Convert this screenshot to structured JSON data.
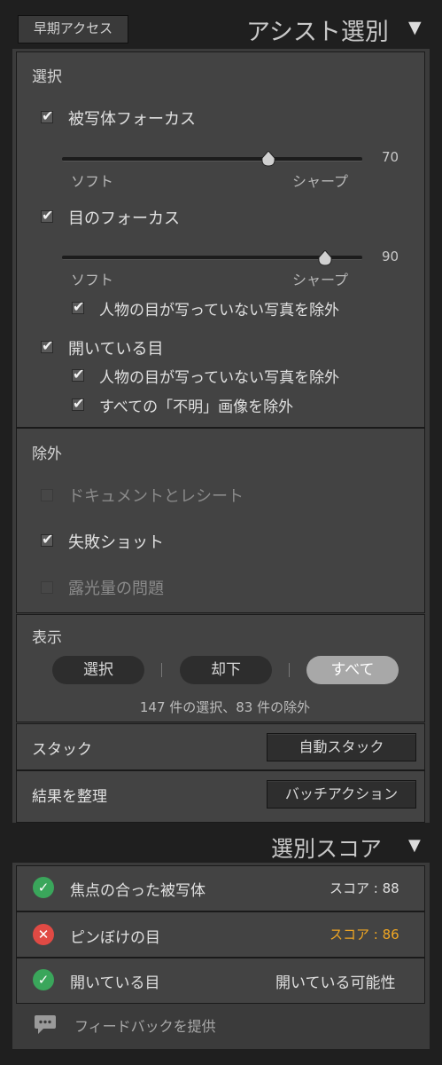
{
  "header": {
    "early_access_label": "早期アクセス",
    "title": "アシスト選別",
    "collapse_glyph": "▼"
  },
  "select_section": {
    "heading": "選択",
    "subject_focus": {
      "label": "被写体フォーカス",
      "checked": true,
      "value": "70",
      "value_fraction": 0.7,
      "min_label": "ソフト",
      "max_label": "シャープ"
    },
    "eye_focus": {
      "label": "目のフォーカス",
      "checked": true,
      "value": "90",
      "value_fraction": 0.9,
      "min_label": "ソフト",
      "max_label": "シャープ",
      "exclude_no_eyes": "人物の目が写っていない写真を除外"
    },
    "open_eyes": {
      "label": "開いている目",
      "checked": true,
      "exclude_no_eyes": "人物の目が写っていない写真を除外",
      "exclude_unknown": "すべての「不明」画像を除外"
    }
  },
  "exclude_section": {
    "heading": "除外",
    "items": [
      {
        "label": "ドキュメントとレシート",
        "checked": false
      },
      {
        "label": "失敗ショット",
        "checked": true
      },
      {
        "label": "露光量の問題",
        "checked": false
      }
    ]
  },
  "display_section": {
    "heading": "表示",
    "tabs": [
      "選択",
      "却下",
      "すべて"
    ],
    "active_tab": "すべて",
    "summary": "147 件の選択、83 件の除外"
  },
  "stack": {
    "label": "スタック",
    "button": "自動スタック"
  },
  "organize": {
    "label": "結果を整理",
    "button": "バッチアクション"
  },
  "score_header": {
    "title": "選別スコア",
    "collapse_glyph": "▼"
  },
  "scores": [
    {
      "label": "焦点の合った被写体",
      "status": "ok",
      "value": "スコア : 88"
    },
    {
      "label": "ピンぼけの目",
      "status": "ng",
      "value": "スコア : 86"
    },
    {
      "label": "開いている目",
      "status": "ok",
      "value": "開いている可能性"
    }
  ],
  "feedback": {
    "label": "フィードバックを提供"
  },
  "colors": {
    "accent_warning": "#f0a623",
    "ok_green": "#3aa65b",
    "ng_red": "#e04a44"
  }
}
